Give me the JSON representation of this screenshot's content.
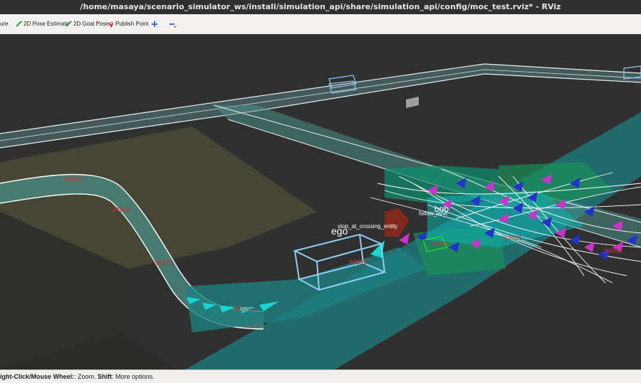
{
  "window": {
    "title": "/home/masaya/scenario_simulator_ws/install/simulation_api/share/simulation_api/config/moc_test.rviz* - RViz"
  },
  "toolbar": {
    "items": [
      {
        "label": "ure",
        "icon": "measure-icon"
      },
      {
        "label": "2D Pose Estimate",
        "icon": "pose-estimate-arrow-icon"
      },
      {
        "label": "2D Goal Pose",
        "icon": "goal-pose-arrow-icon"
      },
      {
        "label": "Publish Point",
        "icon": "map-pin-icon"
      },
      {
        "label": "",
        "icon": "add-tool-icon"
      },
      {
        "label": "",
        "icon": "remove-tool-icon"
      }
    ]
  },
  "viewport": {
    "labels": {
      "ego": "ego",
      "bob": "bob",
      "stop_entity": "stop_at_crossing_entity",
      "follow_lane": "follow_lane",
      "lane_ids": [
        "34981",
        "34606",
        "34975",
        "34576",
        "34408",
        "34561",
        "34621",
        "34600"
      ]
    },
    "colors": {
      "background": "#303030",
      "lane_fill": "#4a8f86",
      "lane_border": "#ffffff",
      "crosswalk_teal": "#1e7f80",
      "ego_box": "#8ecff5",
      "olive_area": "#4a4a36",
      "magenta_marker": "#cc33cc",
      "blue_marker": "#2233cc"
    }
  },
  "statusbar": {
    "key1": "ight-Click/Mouse Wheel:",
    "text1": ": Zoom.",
    "key2": "Shift",
    "text2": ": More options."
  }
}
